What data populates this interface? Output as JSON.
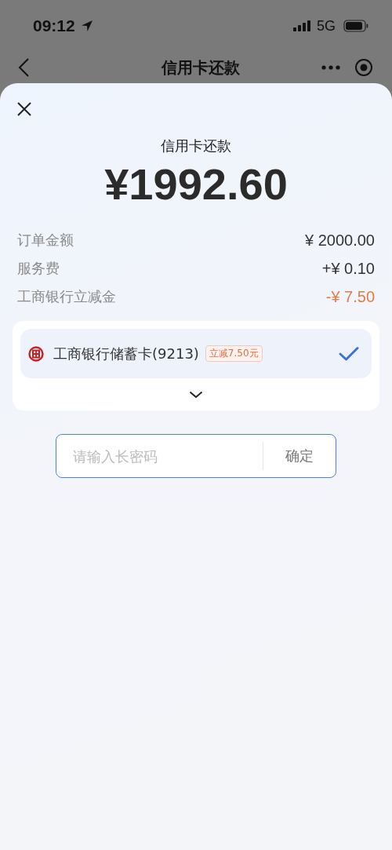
{
  "status_bar": {
    "time": "09:12",
    "network": "5G"
  },
  "nav": {
    "title": "信用卡还款"
  },
  "sheet": {
    "title": "信用卡还款",
    "amount": "¥1992.60",
    "fees": [
      {
        "label": "订单金额",
        "value": "¥ 2000.00",
        "kind": "plain"
      },
      {
        "label": "服务费",
        "value": "+¥ 0.10",
        "kind": "plain"
      },
      {
        "label": "工商银行立减金",
        "value": "-¥ 7.50",
        "kind": "discount"
      }
    ],
    "payment_methods": [
      {
        "name": "工商银行储蓄卡(9213)",
        "badge": "立减7.50元",
        "selected": true
      }
    ],
    "password": {
      "placeholder": "请输入长密码",
      "button": "确定"
    }
  }
}
